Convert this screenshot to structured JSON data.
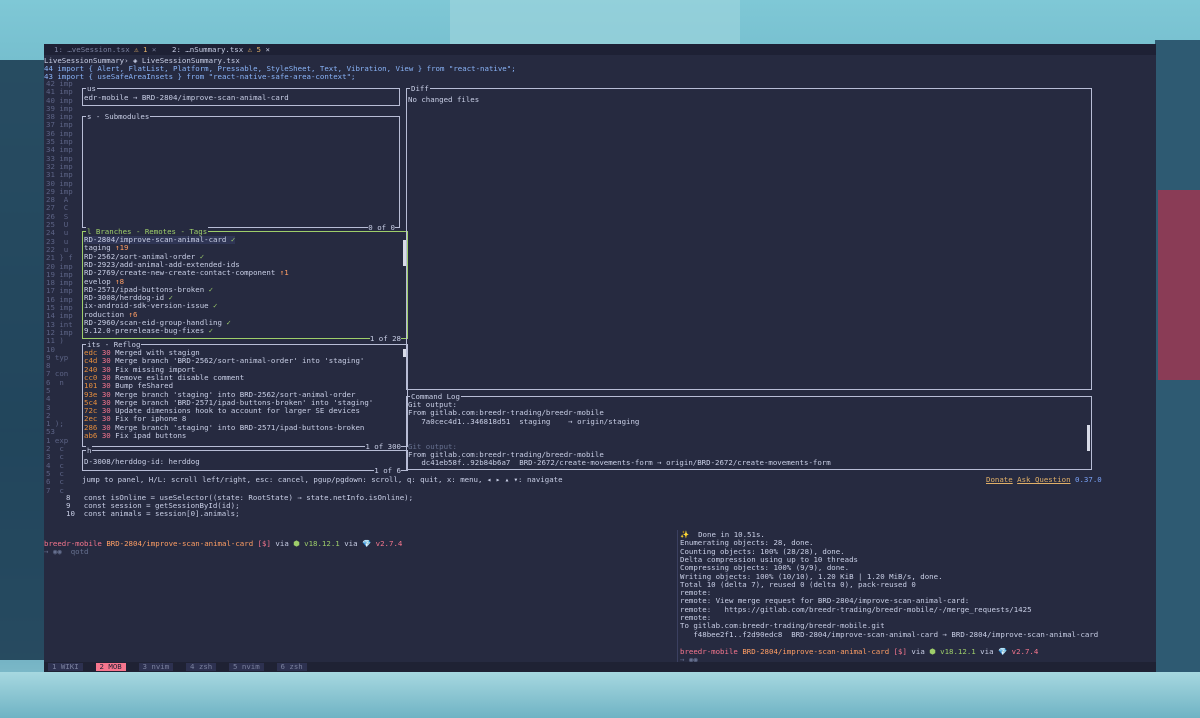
{
  "editor": {
    "tabs": [
      {
        "label": "1: …veSession.tsx",
        "warn": "⚠ 1"
      },
      {
        "label": "2: …nSummary.tsx",
        "warn": "⚠ 5"
      }
    ],
    "breadcrumb": "LiveSessionSummary› ◈ LiveSessionSummary.tsx",
    "line44": "44 import { Alert, FlatList, Platform, Pressable, StyleSheet, Text, Vibration, View } from \"react-native\";",
    "line43": "43 import { useSafeAreaInsets } from \"react-native-safe-area-context\";",
    "gutter": [
      "42 imp",
      "41 imp",
      "40 imp",
      "39 imp",
      "38 imp",
      "37 imp",
      "36 imp",
      "35 imp",
      "34 imp",
      "33 imp",
      "32 imp",
      "31 imp",
      "30 imp",
      "29 imp",
      "28  A",
      "27  C",
      "26  S",
      "25  U",
      "24  u",
      "23  u",
      "22  u",
      "21 } f",
      "20 imp",
      "19 imp",
      "18 imp",
      "17 imp",
      "16 imp",
      "15 imp",
      "14 imp",
      "13 int",
      "12 imp",
      "11 )",
      "10",
      "9 typ",
      "8",
      "7 con",
      "6  n",
      "5",
      "4",
      "3",
      "2",
      "1 );",
      "53",
      "1 exp",
      "2  c",
      "3  c",
      "4  c",
      "5  c",
      "6  c",
      "7  c"
    ],
    "code8": "8   const isOnline = useSelector((state: RootState) ⇒ state.netInfo.isOnline);",
    "code9": "9   const session = getSessionById(id);",
    "code10": "10  const animals = session[0].animals;"
  },
  "lazygit": {
    "status_title": "us",
    "status_text": "edr-mobile → BRD-2804/improve-scan-animal-card",
    "files_title": "s - Submodules",
    "files_count": "0 of 0",
    "branches_title": "l Branches - Remotes - Tags",
    "branches": [
      {
        "name": "RD-2804/improve-scan-animal-card",
        "suffix": " ✓",
        "c": "green"
      },
      {
        "name": "taging",
        "suffix": " ↑19",
        "c": "orange"
      },
      {
        "name": "RD-2562/sort-animal-order",
        "suffix": " ✓",
        "c": "green"
      },
      {
        "name": "RD-2923/add-animal-add-extended-ids",
        "suffix": "",
        "c": ""
      },
      {
        "name": "RD-2769/create-new-create-contact-component",
        "suffix": " ↑1",
        "c": "orange"
      },
      {
        "name": "evelop",
        "suffix": " ↑8",
        "c": "orange"
      },
      {
        "name": "RD-2571/ipad-buttons-broken",
        "suffix": " ✓",
        "c": "green"
      },
      {
        "name": "RD-3008/herddog-id",
        "suffix": " ✓",
        "c": "green"
      },
      {
        "name": "ix-android-sdk-version-issue",
        "suffix": " ✓",
        "c": "green"
      },
      {
        "name": "roduction",
        "suffix": " ↑6",
        "c": "orange"
      },
      {
        "name": "RD-2960/scan-eid-group-handling",
        "suffix": " ✓",
        "c": "green"
      },
      {
        "name": "9.12.0-prerelease-bug-fixes",
        "suffix": " ✓",
        "c": "green"
      }
    ],
    "branches_count": "1 of 28",
    "commits_title": "its - Reflog",
    "commits": [
      {
        "hash": "edc",
        "n": "30",
        "msg": "Merged with stagign"
      },
      {
        "hash": "c4d",
        "n": "30",
        "msg": "Merge branch 'BRD-2562/sort-animal-order' into 'staging'"
      },
      {
        "hash": "240",
        "n": "30",
        "msg": "Fix missing import"
      },
      {
        "hash": "cc0",
        "n": "30",
        "msg": "Remove eslint disable comment"
      },
      {
        "hash": "101",
        "n": "30",
        "msg": "Bump feShared"
      },
      {
        "hash": "93e",
        "n": "30",
        "msg": "Merge branch 'staging' into BRD-2562/sort-animal-order"
      },
      {
        "hash": "5c4",
        "n": "30",
        "msg": "Merge branch 'BRD-2571/ipad-buttons-broken' into 'staging'"
      },
      {
        "hash": "72c",
        "n": "30",
        "msg": "Update dimensions hook to account for larger SE devices"
      },
      {
        "hash": "2ec",
        "n": "30",
        "msg": "Fix for iphone 8"
      },
      {
        "hash": "286",
        "n": "30",
        "msg": "Merge branch 'staging' into BRD-2571/ipad-buttons-broken"
      },
      {
        "hash": "ab6",
        "n": "30",
        "msg": "Fix ipad buttons"
      }
    ],
    "commits_count": "1 of 300",
    "stash_title": "h",
    "stash_text": "D-3008/herddog-id: herddog",
    "stash_count": "1 of 6",
    "diff_title": "Diff",
    "diff_text": "No changed files",
    "cmdlog_title": "Command Log",
    "cmdlog": [
      {
        "t": "Git output:",
        "c": ""
      },
      {
        "t": "From gitlab.com:breedr-trading/breedr-mobile",
        "c": ""
      },
      {
        "t": "   7a0cec4d1..346818d51  staging    → origin/staging",
        "c": ""
      },
      {
        "t": "",
        "c": ""
      },
      {
        "t": "",
        "c": ""
      },
      {
        "t": "Git output:",
        "c": "gr"
      },
      {
        "t": "From gitlab.com:breedr-trading/breedr-mobile",
        "c": ""
      },
      {
        "t": "   dc41eb58f..92b84b6a7  BRD-2672/create-movements-form → origin/BRD-2672/create-movements-form",
        "c": ""
      }
    ],
    "help": "jump to panel, H/L: scroll left/right, esc: cancel, pgup/pgdown: scroll, q: quit, x: menu, ◂ ▸ ▴ ▾: navigate",
    "donate": "Donate",
    "ask": "Ask Question",
    "version": "0.37.0"
  },
  "shell_left": {
    "prompt_dir": "breedr-mobile",
    "prompt_branch": "BRD-2804/improve-scan-animal-card",
    "prompt_flags": "[$]",
    "via1": "via",
    "node": "⬢ v18.12.1",
    "via2": "via",
    "ruby": "💎 v2.7.4",
    "cmd": "→ ◉◉  qotd"
  },
  "shell_right": {
    "lines": [
      "✨  Done in 10.51s.",
      "Enumerating objects: 28, done.",
      "Counting objects: 100% (28/28), done.",
      "Delta compression using up to 10 threads",
      "Compressing objects: 100% (9/9), done.",
      "Writing objects: 100% (10/10), 1.20 KiB | 1.20 MiB/s, done.",
      "Total 10 (delta 7), reused 0 (delta 0), pack-reused 0",
      "remote:",
      "remote: View merge request for BRD-2804/improve-scan-animal-card:",
      "remote:   https://gitlab.com/breedr-trading/breedr-mobile/-/merge_requests/1425",
      "remote:",
      "To gitlab.com:breedr-trading/breedr-mobile.git",
      "   f48bee2f1..f2d90edc8  BRD-2804/improve-scan-animal-card → BRD-2804/improve-scan-animal-card"
    ],
    "prompt_dir": "breedr-mobile",
    "prompt_branch": "BRD-2804/improve-scan-animal-card",
    "prompt_flags": "[$]",
    "node": "⬢ v18.12.1",
    "ruby": "💎 v2.7.4",
    "cmd": "→ ◉◉"
  },
  "tmux": {
    "tabs": [
      {
        "label": "1  WIKI",
        "active": false
      },
      {
        "label": "2  MOB",
        "active": true
      },
      {
        "label": "3  nvim",
        "active": false
      },
      {
        "label": "4  zsh",
        "active": false
      },
      {
        "label": "5  nvim",
        "active": false
      },
      {
        "label": "6  zsh",
        "active": false
      }
    ]
  },
  "colors": {
    "accent": "#9ece6a",
    "bg": "#262a40",
    "hash": "#e58d3d",
    "active_tab": "#f7768e"
  }
}
